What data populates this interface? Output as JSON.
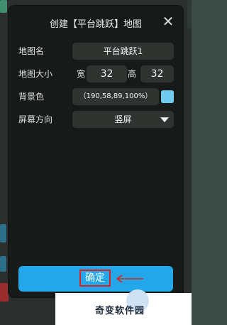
{
  "dialog": {
    "title": "创建【平台跳跃】地图",
    "close_glyph": "✕"
  },
  "form": {
    "map_name": {
      "label": "地图名",
      "value": "平台跳跃1"
    },
    "map_size": {
      "label": "地图大小",
      "width_label": "宽",
      "width_value": "32",
      "height_label": "高",
      "height_value": "32"
    },
    "background_color": {
      "label": "背景色",
      "value": "（190,58,89,100%）",
      "swatch_color": "#6ecbef"
    },
    "orientation": {
      "label": "屏幕方向",
      "value": "竖屏"
    }
  },
  "confirm": {
    "label": "确定"
  },
  "annotation": {
    "color": "#e0201b"
  },
  "watermark": {
    "text": "奇变软件园"
  },
  "colors": {
    "dialog_bg": "#161a18",
    "field_bg": "#2f3431",
    "confirm_bg": "#23a7ea"
  }
}
